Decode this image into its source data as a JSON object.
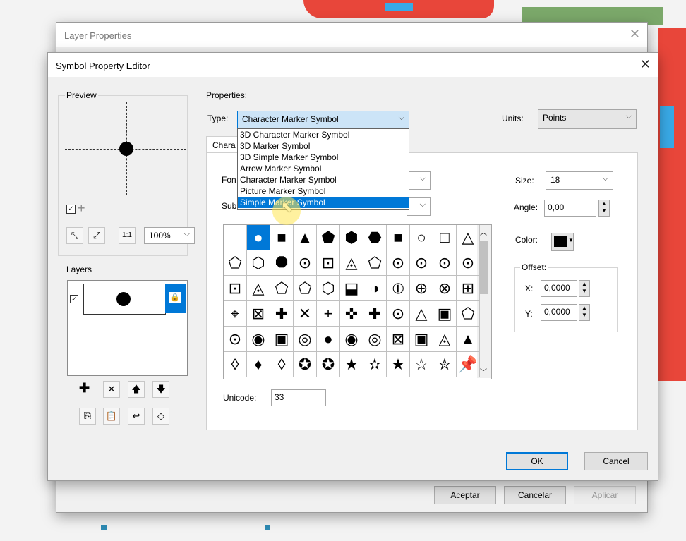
{
  "layer_properties": {
    "title": "Layer Properties",
    "close": "✕",
    "aceptar": "Aceptar",
    "cancelar": "Cancelar",
    "aplicar": "Aplicar"
  },
  "editor": {
    "title": "Symbol Property Editor",
    "close": "✕",
    "preview_label": "Preview",
    "preview_zoom": "100%",
    "layers_label": "Layers",
    "properties_label": "Properties:",
    "type_label": "Type:",
    "type_value": "Character Marker Symbol",
    "units_label": "Units:",
    "units_value": "Points",
    "tab_label": "Chara",
    "font_label": "Fon",
    "subset_label": "Sub",
    "size_label": "Size:",
    "size_value": "18",
    "angle_label": "Angle:",
    "angle_value": "0,00",
    "color_label": "Color:",
    "offset_label": "Offset:",
    "x_label": "X:",
    "x_value": "0,0000",
    "y_label": "Y:",
    "y_value": "0,0000",
    "unicode_label": "Unicode:",
    "unicode_value": "33",
    "ok": "OK",
    "cancel": "Cancel"
  },
  "type_options": [
    "3D Character Marker Symbol",
    "3D Marker Symbol",
    "3D Simple Marker Symbol",
    "Arrow Marker Symbol",
    "Character Marker Symbol",
    "Picture Marker Symbol",
    "Simple Marker Symbol"
  ],
  "type_highlighted": "Simple Marker Symbol",
  "glyphs": [
    [
      " ",
      "●",
      "■",
      "▲",
      "⬟",
      "⬢",
      "⬣",
      "■",
      "○",
      "□",
      "△"
    ],
    [
      "⬠",
      "⬡",
      "⯃",
      "⊙",
      "⊡",
      "◬",
      "⬠",
      "⊙",
      "⊙",
      "⊙",
      "⊙"
    ],
    [
      "⊡",
      "◬",
      "⬠",
      "⬠",
      "⬡",
      "⬓",
      "◑",
      "⦶",
      "⊕",
      "⊗",
      "⊞"
    ],
    [
      "⌖",
      "⊠",
      "✚",
      "✕",
      "+",
      "✜",
      "✚",
      "⊙",
      "△",
      "▣",
      "⬠"
    ],
    [
      "⊙",
      "◉",
      "▣",
      "◎",
      "●",
      "◉",
      "◎",
      "⊠",
      "▣",
      "◬",
      "▲"
    ],
    [
      "◊",
      "♦",
      "◊",
      "✪",
      "✪",
      "★",
      "✫",
      "★",
      "☆",
      "✮",
      "📌"
    ]
  ],
  "colors": {
    "accent": "#0078d7",
    "selected_color": "#000000",
    "map_red": "#e8463a"
  },
  "icons": {
    "checkbox": "checkbox-icon",
    "add": "plus-icon"
  }
}
